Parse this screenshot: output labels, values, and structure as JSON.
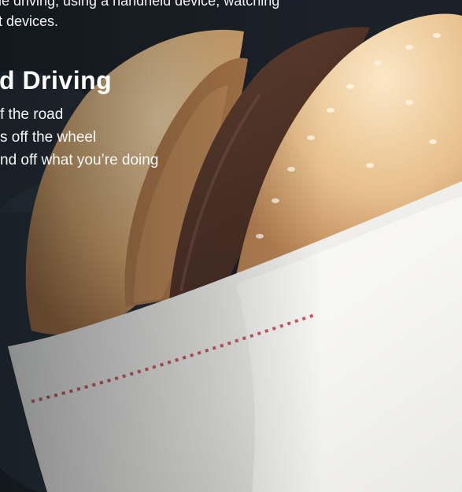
{
  "intro": {
    "line1": "le driving, using a handheld device, watching",
    "line2": "t devices."
  },
  "heading": "d  Driving",
  "items": [
    "f the road",
    "s off the wheel",
    "nd off what you’re doing"
  ],
  "colors": {
    "background": "#1c2127",
    "bun": "#e9c99a",
    "patty": "#5a3a2c",
    "wrapper": "#f2f1ee",
    "wrapper_dots": "#c4404a",
    "text": "#ffffff"
  }
}
